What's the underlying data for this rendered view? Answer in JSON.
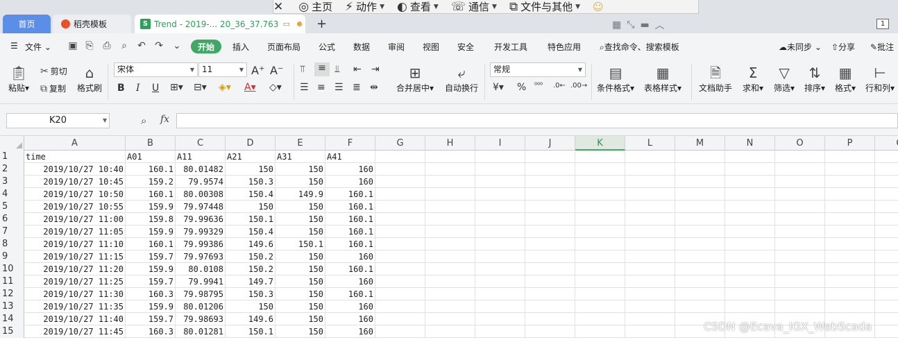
{
  "tabs": {
    "home": "首页",
    "dk": "稻壳模板",
    "trend": "Trend - 2019-... 20_36_37.763",
    "count": "1"
  },
  "overlay": {
    "items": [
      "主页",
      "动作",
      "查看",
      "通信",
      "文件与其他"
    ]
  },
  "menu": {
    "file": "文件",
    "start": "开始",
    "insert": "插入",
    "page_layout": "页面布局",
    "formula": "公式",
    "data": "数据",
    "review": "审阅",
    "view": "视图",
    "security": "安全",
    "dev_tools": "开发工具",
    "features": "特色应用",
    "search": "查找命令、搜索模板",
    "unsync": "未同步",
    "share": "分享",
    "comment": "批注"
  },
  "ribbon": {
    "paste": "粘贴",
    "cut": "剪切",
    "copy": "复制",
    "format_painter": "格式刷",
    "font_name": "宋体",
    "font_size": "11",
    "merge_center": "合并居中",
    "auto_wrap": "自动换行",
    "number_format": "常规",
    "cond_format": "条件格式",
    "table_style": "表格样式",
    "doc_helper": "文档助手",
    "sum": "求和",
    "filter": "筛选",
    "sort": "排序",
    "format": "格式",
    "row_col": "行和列"
  },
  "formula_bar": {
    "name_box": "K20",
    "fx": "fx",
    "value": ""
  },
  "sheet": {
    "columns": [
      "A",
      "B",
      "C",
      "D",
      "E",
      "F",
      "G",
      "H",
      "I",
      "J",
      "K",
      "L",
      "M",
      "N",
      "O",
      "P",
      "Q"
    ],
    "active_column": "K",
    "header": [
      "time",
      "A01",
      "A11",
      "A21",
      "A31",
      "A41"
    ],
    "rows": [
      [
        "2019/10/27 10:40",
        "160.1",
        "80.01482",
        "150",
        "150",
        "160"
      ],
      [
        "2019/10/27 10:45",
        "159.2",
        "79.9574",
        "150.3",
        "150",
        "160"
      ],
      [
        "2019/10/27 10:50",
        "160.1",
        "80.00308",
        "150.4",
        "149.9",
        "160.1"
      ],
      [
        "2019/10/27 10:55",
        "159.9",
        "79.97448",
        "150",
        "150",
        "160.1"
      ],
      [
        "2019/10/27 11:00",
        "159.8",
        "79.99636",
        "150.1",
        "150",
        "160.1"
      ],
      [
        "2019/10/27 11:05",
        "159.9",
        "79.99329",
        "150.4",
        "150",
        "160.1"
      ],
      [
        "2019/10/27 11:10",
        "160.1",
        "79.99386",
        "149.6",
        "150.1",
        "160.1"
      ],
      [
        "2019/10/27 11:15",
        "159.7",
        "79.97693",
        "150.2",
        "150",
        "160"
      ],
      [
        "2019/10/27 11:20",
        "159.9",
        "80.0108",
        "150.2",
        "150",
        "160.1"
      ],
      [
        "2019/10/27 11:25",
        "159.7",
        "79.9941",
        "149.7",
        "150",
        "160"
      ],
      [
        "2019/10/27 11:30",
        "160.3",
        "79.98795",
        "150.3",
        "150",
        "160.1"
      ],
      [
        "2019/10/27 11:35",
        "159.9",
        "80.01206",
        "150",
        "150",
        "160"
      ],
      [
        "2019/10/27 11:40",
        "159.7",
        "79.98693",
        "149.6",
        "150",
        "160"
      ],
      [
        "2019/10/27 11:45",
        "160.3",
        "80.01281",
        "150.1",
        "150",
        "160"
      ]
    ]
  },
  "watermark": "CSDN @Ecava_IGX_WebScada"
}
